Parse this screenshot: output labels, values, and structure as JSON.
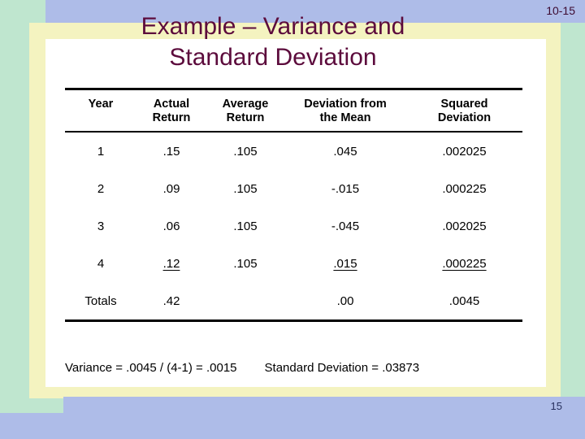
{
  "slide": {
    "marker": "10-15",
    "page_number": "15",
    "title": "Example – Variance and\nStandard Deviation",
    "title_color": "#5c0b3c",
    "frame_color": "#f4f3c0",
    "band_color": "#aebce8",
    "background_color": "#bfe6cf",
    "content_color": "#ffffff"
  },
  "table": {
    "headers": [
      "Year",
      "Actual\nReturn",
      "Average\nReturn",
      "Deviation from\nthe Mean",
      "Squared\nDeviation"
    ],
    "rows": [
      {
        "year": "1",
        "actual": ".15",
        "average": ".105",
        "deviation": ".045",
        "squared": ".002025",
        "underlined": false
      },
      {
        "year": "2",
        "actual": ".09",
        "average": ".105",
        "deviation": "-.015",
        "squared": ".000225",
        "underlined": false
      },
      {
        "year": "3",
        "actual": ".06",
        "average": ".105",
        "deviation": "-.045",
        "squared": ".002025",
        "underlined": false
      },
      {
        "year": "4",
        "actual": ".12",
        "average": ".105",
        "deviation": ".015",
        "squared": ".000225",
        "underlined": true
      }
    ],
    "totals": {
      "year": "Totals",
      "actual": ".42",
      "average": "",
      "deviation": ".00",
      "squared": ".0045",
      "underlined": false
    }
  },
  "footer": {
    "variance": "Variance = .0045 / (4-1) = .0015",
    "standard_deviation": "Standard Deviation = .03873"
  },
  "chart_data": {
    "type": "table",
    "title": "Example – Variance and Standard Deviation",
    "columns": [
      "Year",
      "Actual Return",
      "Average Return",
      "Deviation from the Mean",
      "Squared Deviation"
    ],
    "data": [
      [
        "1",
        ".15",
        ".105",
        ".045",
        ".002025"
      ],
      [
        "2",
        ".09",
        ".105",
        "-.015",
        ".000225"
      ],
      [
        "3",
        ".06",
        ".105",
        "-.045",
        ".002025"
      ],
      [
        "4",
        ".12",
        ".105",
        ".015",
        ".000225"
      ],
      [
        "Totals",
        ".42",
        "",
        ".00",
        ".0045"
      ]
    ],
    "annotations": [
      "Variance = .0045 / (4-1) = .0015",
      "Standard Deviation = .03873"
    ]
  }
}
